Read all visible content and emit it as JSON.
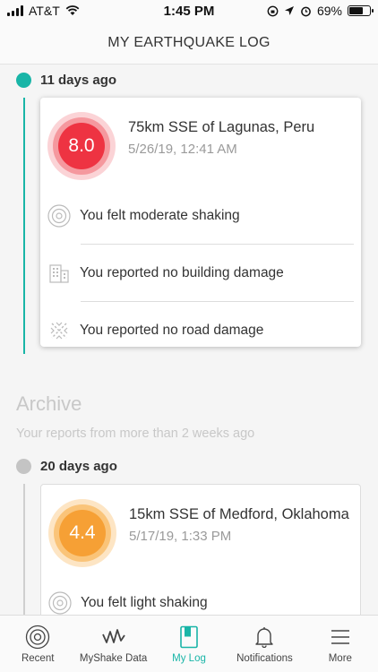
{
  "status": {
    "carrier": "AT&T",
    "time": "1:45 PM",
    "battery": "69%",
    "battery_level": 0.69
  },
  "header": {
    "title": "MY EARTHQUAKE LOG"
  },
  "recent": {
    "day_label": "11 days ago",
    "card": {
      "magnitude": "8.0",
      "location": "75km SSE of Lagunas, Peru",
      "datetime": "5/26/19, 12:41 AM",
      "reports": [
        {
          "icon": "shaking-rings-icon",
          "text": "You felt moderate shaking"
        },
        {
          "icon": "building-icon",
          "text": "You reported no building damage"
        },
        {
          "icon": "road-icon",
          "text": "You reported no road damage"
        }
      ]
    }
  },
  "archive": {
    "title": "Archive",
    "subtitle": "Your reports from more than 2 weeks ago",
    "day_label": "20 days ago",
    "card": {
      "magnitude": "4.4",
      "location": "15km SSE of Medford, Oklahoma",
      "datetime": "5/17/19, 1:33 PM",
      "reports": [
        {
          "icon": "shaking-rings-icon",
          "text": "You felt light shaking"
        }
      ]
    }
  },
  "tabs": [
    {
      "label": "Recent",
      "icon": "target-icon",
      "active": false
    },
    {
      "label": "MyShake Data",
      "icon": "waveform-icon",
      "active": false
    },
    {
      "label": "My Log",
      "icon": "book-icon",
      "active": true
    },
    {
      "label": "Notifications",
      "icon": "bell-icon",
      "active": false
    },
    {
      "label": "More",
      "icon": "menu-icon",
      "active": false
    }
  ],
  "colors": {
    "accent": "#19b5a7",
    "mag_high": "#ee3342",
    "mag_mid": "#f6a035"
  }
}
